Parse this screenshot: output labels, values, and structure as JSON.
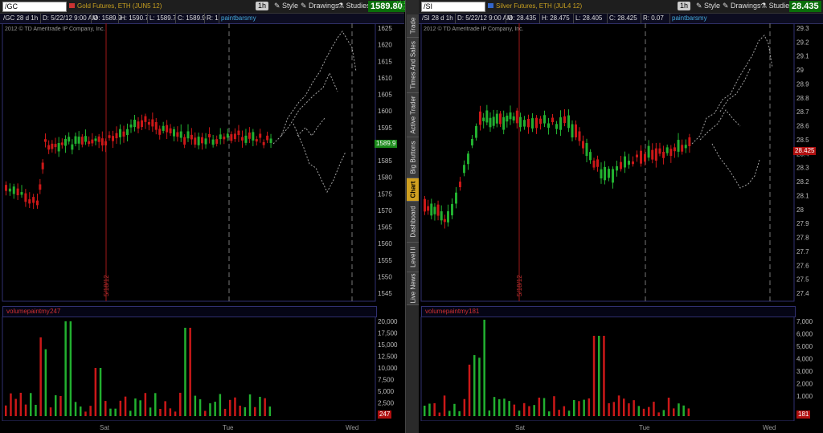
{
  "left": {
    "symbol": "/GC",
    "description": "Gold Futures, ETH (JUN5 12)",
    "aggregation": "1h",
    "style_label": "Style",
    "drawings_label": "Drawings",
    "studies_label": "Studies",
    "last_price": "1589.80",
    "change_top": "+1.10",
    "change_bottom": "+0.07%",
    "info_symbol": "/GC 28 d 1h",
    "info_date": "D: 5/22/12 9:00 AM",
    "info_open": "O: 1589.9",
    "info_high": "H: 1590.7",
    "info_low": "L: 1589.7",
    "info_close": "C: 1589.9",
    "info_range": "R: 1",
    "study_tag": "paintbarsmy",
    "copyright": "2012 © TD Ameritrade IP Company, Inc.",
    "marker_label": "5/18/12",
    "price_axis": [
      "1625",
      "1620",
      "1615",
      "1610",
      "1605",
      "1600",
      "1595",
      "1590",
      "1585",
      "1580",
      "1575",
      "1570",
      "1565",
      "1560",
      "1555",
      "1550",
      "1545"
    ],
    "last_tag": "1589.9",
    "volume_title": "volumepaintmy",
    "volume_value": "247",
    "volume_tag": "247",
    "volume_axis": [
      "20,000",
      "17,500",
      "15,000",
      "12,500",
      "10,000",
      "7,500",
      "5,000",
      "2,500"
    ],
    "dates": [
      "Sat",
      "Tue",
      "Wed"
    ]
  },
  "right": {
    "symbol": "/SI",
    "description": "Silver Futures, ETH (JUL4 12)",
    "aggregation": "1h",
    "style_label": "Style",
    "drawings_label": "Drawings",
    "studies_label": "Studies",
    "last_price": "28.435",
    "info_symbol": "/SI 28 d 1h",
    "info_date": "D: 5/22/12 9:00 AM",
    "info_open": "O: 28.435",
    "info_high": "H: 28.475",
    "info_low": "L: 28.405",
    "info_close": "C: 28.425",
    "info_range": "R: 0.07",
    "study_tag": "paintbarsmy",
    "copyright": "2012 © TD Ameritrade IP Company, Inc.",
    "marker_label": "5/18/12",
    "price_axis": [
      "29.3",
      "29.2",
      "29.1",
      "29",
      "28.9",
      "28.8",
      "28.7",
      "28.6",
      "28.5",
      "28.4",
      "28.3",
      "28.2",
      "28.1",
      "28",
      "27.9",
      "27.8",
      "27.7",
      "27.6",
      "27.5",
      "27.4"
    ],
    "last_tag": "28.425",
    "volume_title": "volumepaintmy",
    "volume_value": "181",
    "volume_tag": "181",
    "volume_axis": [
      "7,000",
      "6,000",
      "5,000",
      "4,000",
      "3,000",
      "2,000",
      "1,000"
    ],
    "dates": [
      "Sat",
      "Tue",
      "Wed"
    ]
  },
  "side_tabs": [
    "Trade",
    "Times And Sales",
    "Active Trader",
    "Big Buttons",
    "Chart",
    "Dashboard",
    "Level II",
    "Live News"
  ],
  "active_tab": "Chart",
  "colors": {
    "up": "#22b030",
    "down": "#cc1818",
    "background": "#000000",
    "projection": "#cccccc",
    "tab_active": "#d0a020"
  }
}
